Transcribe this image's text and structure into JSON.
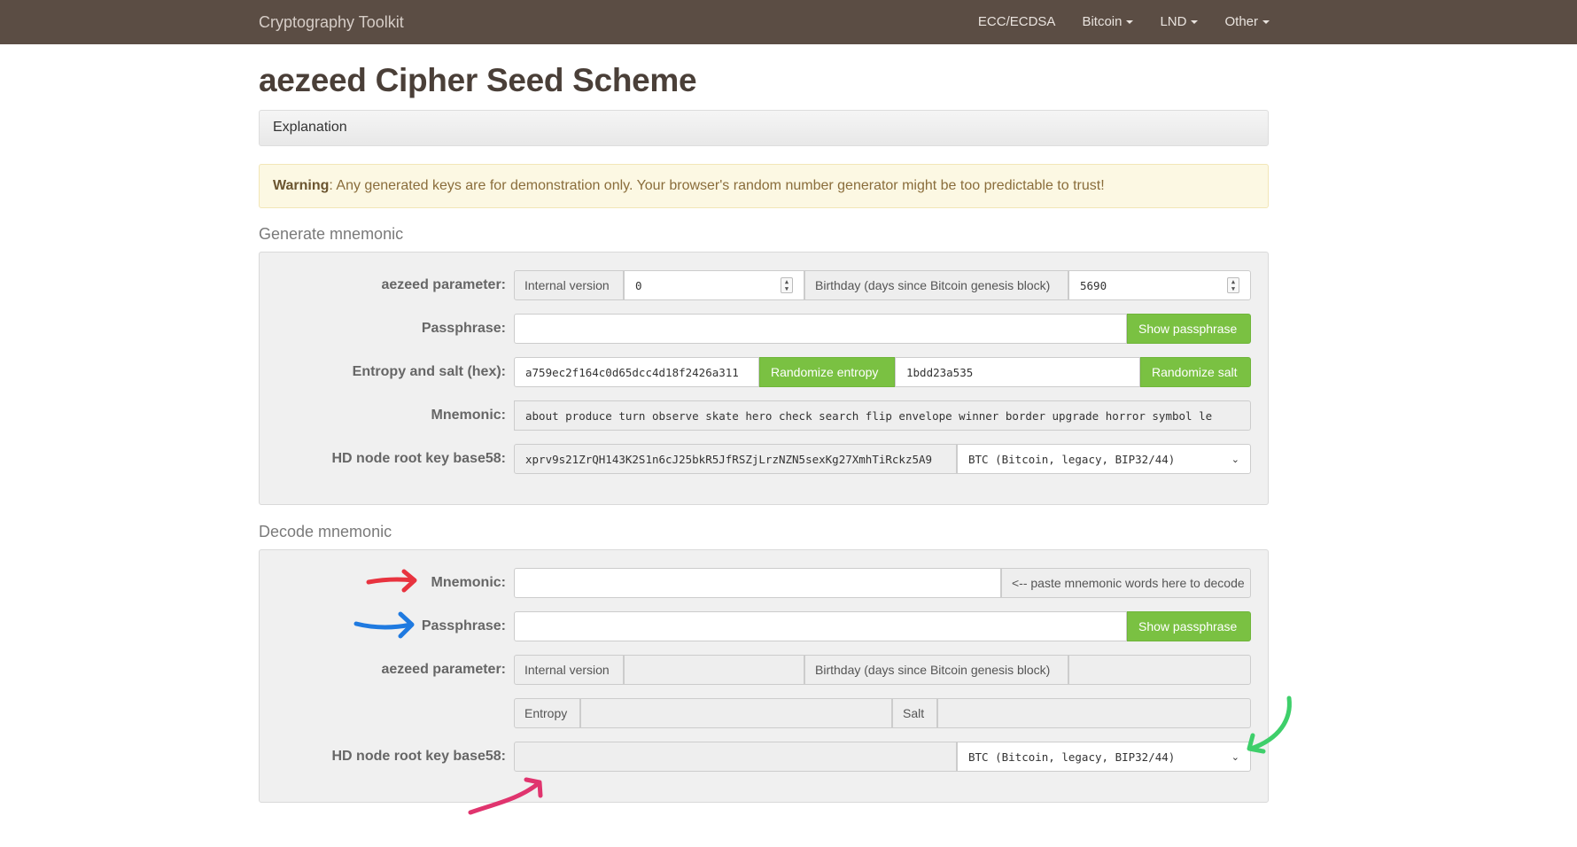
{
  "nav": {
    "brand": "Cryptography Toolkit",
    "items": [
      {
        "label": "ECC/ECDSA",
        "dropdown": false
      },
      {
        "label": "Bitcoin",
        "dropdown": true
      },
      {
        "label": "LND",
        "dropdown": true
      },
      {
        "label": "Other",
        "dropdown": true
      }
    ]
  },
  "page": {
    "title": "aezeed Cipher Seed Scheme",
    "explanation": "Explanation",
    "warning_strong": "Warning",
    "warning_text": ": Any generated keys are for demonstration only. Your browser's random number generator might be too predictable to trust!"
  },
  "generate": {
    "section_title": "Generate mnemonic",
    "aezeed_label": "aezeed parameter:",
    "internal_version_label": "Internal version",
    "internal_version_value": "0",
    "birthday_label": "Birthday (days since Bitcoin genesis block)",
    "birthday_value": "5690",
    "passphrase_label": "Passphrase:",
    "passphrase_value": "",
    "show_passphrase": "Show passphrase",
    "entropy_label": "Entropy and salt (hex):",
    "entropy_value": "a759ec2f164c0d65dcc4d18f2426a311",
    "randomize_entropy": "Randomize entropy",
    "salt_value": "1bdd23a535",
    "randomize_salt": "Randomize salt",
    "mnemonic_label": "Mnemonic:",
    "mnemonic_value": "about produce turn observe skate hero check search flip envelope winner border upgrade horror symbol le",
    "hdnode_label": "HD node root key base58:",
    "hdnode_value": "xprv9s21ZrQH143K2S1n6cJ25bkR5JfRSZjLrzNZN5sexKg27XmhTiRckz5A9",
    "network_selected": "BTC (Bitcoin, legacy, BIP32/44)"
  },
  "decode": {
    "section_title": "Decode mnemonic",
    "mnemonic_label": "Mnemonic:",
    "mnemonic_value": "",
    "paste_hint": "<-- paste mnemonic words here to decode",
    "passphrase_label": "Passphrase:",
    "passphrase_value": "",
    "show_passphrase": "Show passphrase",
    "aezeed_label": "aezeed parameter:",
    "internal_version_label": "Internal version",
    "internal_version_value": "",
    "birthday_label": "Birthday (days since Bitcoin genesis block)",
    "birthday_value": "",
    "entropy_label": "Entropy",
    "entropy_value": "",
    "salt_label": "Salt",
    "salt_value": "",
    "hdnode_label": "HD node root key base58:",
    "hdnode_value": "",
    "network_selected": "BTC (Bitcoin, legacy, BIP32/44)"
  },
  "colors": {
    "navbar": "#5b4d44",
    "accent_green": "#7ac142",
    "arrow_red": "#e8333f",
    "arrow_blue": "#1f7ae0",
    "arrow_green": "#3ecf6a",
    "arrow_pink": "#e0346e"
  }
}
